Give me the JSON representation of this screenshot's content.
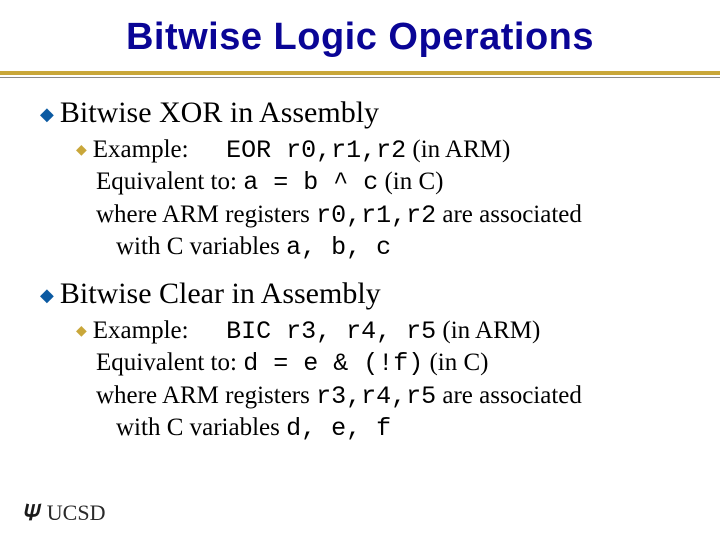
{
  "title": "Bitwise Logic Operations",
  "section1": {
    "heading": "Bitwise XOR in Assembly",
    "example_label": "Example:",
    "asm_code": "EOR r0,r1,r2",
    "asm_note": " (in ARM)",
    "equiv_label": "Equivalent to: ",
    "equiv_code": "a = b ^ c",
    "equiv_note": " (in C)",
    "where_pre": "where ARM registers ",
    "where_code": "r0,r1,r2",
    "where_mid": " are associated",
    "where_line2_pre": "with C variables ",
    "where_line2_code": "a, b, c"
  },
  "section2": {
    "heading": "Bitwise Clear in Assembly",
    "example_label": "Example:",
    "asm_code": "BIC r3, r4, r5",
    "asm_note": " (in ARM)",
    "equiv_label": "Equivalent to: ",
    "equiv_code": "d = e & (!f)",
    "equiv_note": " (in C)",
    "where_pre": "where ARM registers ",
    "where_code": "r3,r4,r5",
    "where_mid": " are associated",
    "where_line2_pre": "with C variables ",
    "where_line2_code": "d, e, f"
  },
  "logo": "UCSD"
}
